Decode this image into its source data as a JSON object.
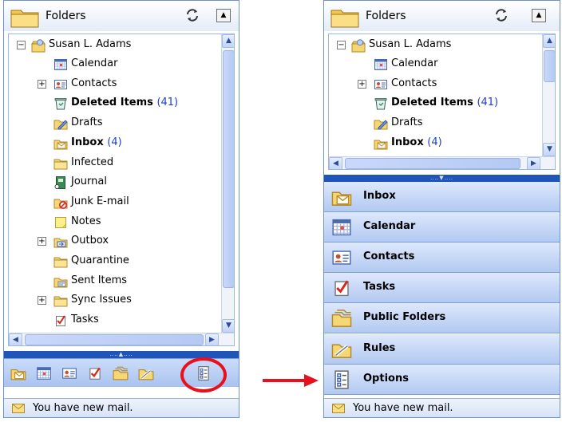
{
  "left_pane": {
    "header_title": "Folders",
    "root_label": "Susan L. Adams",
    "folders": [
      {
        "label": "Calendar",
        "count": "",
        "icon": "calendar-icon",
        "expander": ""
      },
      {
        "label": "Contacts",
        "count": "",
        "icon": "contacts-icon",
        "expander": "+"
      },
      {
        "label": "Deleted Items",
        "count": "(41)",
        "icon": "deleted-items-icon",
        "expander": ""
      },
      {
        "label": "Drafts",
        "count": "",
        "icon": "drafts-icon",
        "expander": ""
      },
      {
        "label": "Inbox",
        "count": "(4)",
        "icon": "inbox-icon",
        "expander": ""
      },
      {
        "label": "Infected",
        "count": "",
        "icon": "folder-icon",
        "expander": ""
      },
      {
        "label": "Journal",
        "count": "",
        "icon": "journal-icon",
        "expander": ""
      },
      {
        "label": "Junk E-mail",
        "count": "",
        "icon": "junk-email-icon",
        "expander": ""
      },
      {
        "label": "Notes",
        "count": "",
        "icon": "notes-icon",
        "expander": ""
      },
      {
        "label": "Outbox",
        "count": "",
        "icon": "outbox-icon",
        "expander": "+"
      },
      {
        "label": "Quarantine",
        "count": "",
        "icon": "folder-icon",
        "expander": ""
      },
      {
        "label": "Sent Items",
        "count": "",
        "icon": "sent-items-icon",
        "expander": ""
      },
      {
        "label": "Sync Issues",
        "count": "",
        "icon": "folder-icon",
        "expander": "+"
      },
      {
        "label": "Tasks",
        "count": "",
        "icon": "tasks-icon",
        "expander": ""
      }
    ],
    "status_text": "You have new mail."
  },
  "right_pane": {
    "header_title": "Folders",
    "root_label": "Susan L. Adams",
    "folders": [
      {
        "label": "Calendar",
        "count": "",
        "icon": "calendar-icon",
        "expander": ""
      },
      {
        "label": "Contacts",
        "count": "",
        "icon": "contacts-icon",
        "expander": "+"
      },
      {
        "label": "Deleted Items",
        "count": "(41)",
        "icon": "deleted-items-icon",
        "expander": ""
      },
      {
        "label": "Drafts",
        "count": "",
        "icon": "drafts-icon",
        "expander": ""
      },
      {
        "label": "Inbox",
        "count": "(4)",
        "icon": "inbox-icon",
        "expander": ""
      }
    ],
    "nav_buttons": [
      {
        "label": "Inbox",
        "icon": "inbox-icon"
      },
      {
        "label": "Calendar",
        "icon": "calendar-icon"
      },
      {
        "label": "Contacts",
        "icon": "contacts-icon"
      },
      {
        "label": "Tasks",
        "icon": "tasks-icon"
      },
      {
        "label": "Public Folders",
        "icon": "public-folders-icon"
      },
      {
        "label": "Rules",
        "icon": "rules-icon"
      },
      {
        "label": "Options",
        "icon": "options-icon"
      }
    ],
    "status_text": "You have new mail."
  },
  "colors": {
    "selection": "#3169c6",
    "count_text": "#1e3ed3",
    "pane_border": "#6f93c7",
    "splitter": "#1f54b8",
    "annotation_red": "#e8101c"
  }
}
